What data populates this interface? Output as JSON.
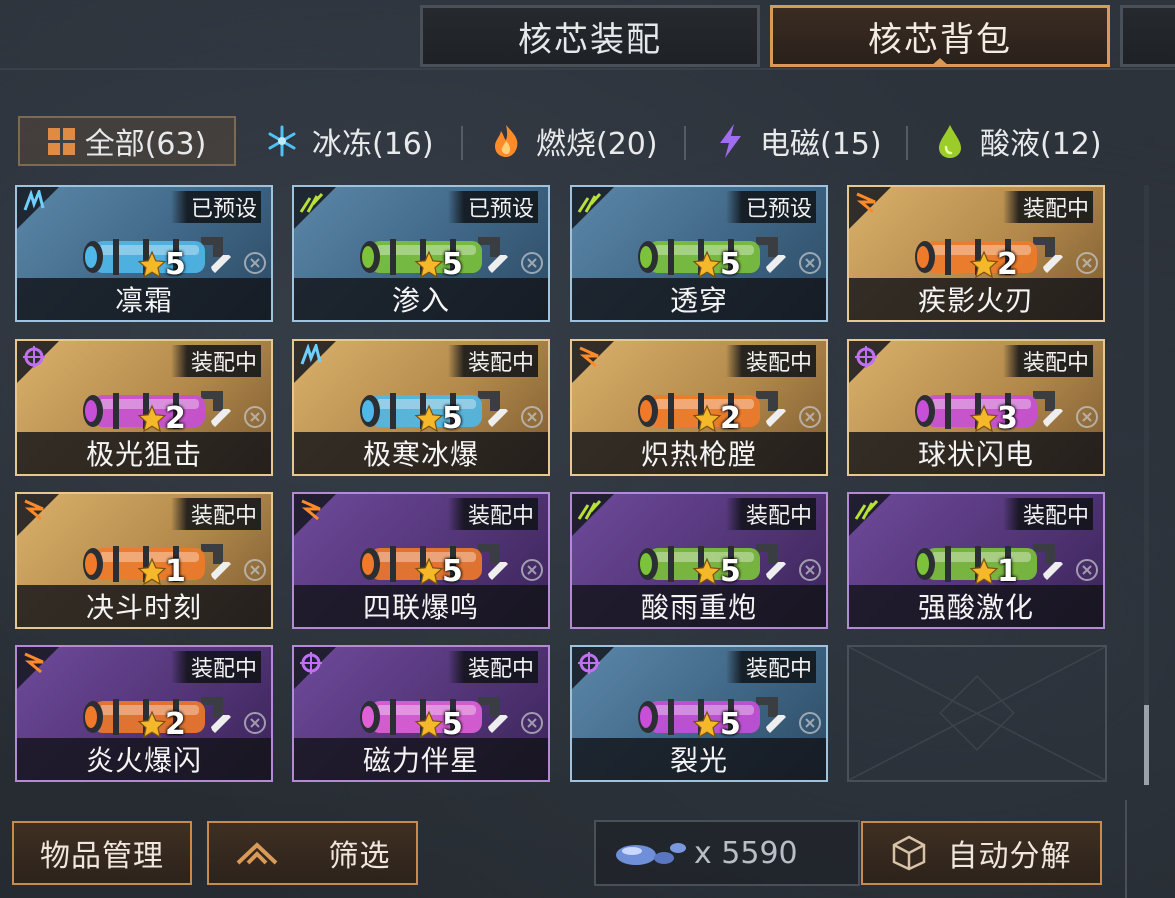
{
  "tabs": [
    {
      "label": "核芯装配",
      "active": false
    },
    {
      "label": "核芯背包",
      "active": true
    },
    {
      "label": "",
      "active": false
    }
  ],
  "filters": [
    {
      "label": "全部(63)",
      "icon": "grid-icon",
      "color": "#e08b44"
    },
    {
      "label": "冰冻(16)",
      "icon": "snowflake-icon",
      "color": "#4fc3f7"
    },
    {
      "label": "燃烧(20)",
      "icon": "flame-icon",
      "color": "#ff8a2a"
    },
    {
      "label": "电磁(15)",
      "icon": "lightning-icon",
      "color": "#a06cf0"
    },
    {
      "label": "酸液(12)",
      "icon": "acid-drop-icon",
      "color": "#9ccc2a"
    }
  ],
  "cores": [
    {
      "name": "凛霜",
      "status": "已预设",
      "rarity": "5",
      "frame": "blue",
      "element": "ice",
      "gun_color": "#4fb8e8"
    },
    {
      "name": "渗入",
      "status": "已预设",
      "rarity": "5",
      "frame": "blue",
      "element": "acid",
      "gun_color": "#7cc23a"
    },
    {
      "name": "透穿",
      "status": "已预设",
      "rarity": "5",
      "frame": "blue",
      "element": "acid",
      "gun_color": "#7cc23a"
    },
    {
      "name": "疾影火刃",
      "status": "装配中",
      "rarity": "2",
      "frame": "gold",
      "element": "fire",
      "gun_color": "#f07a2a"
    },
    {
      "name": "极光狙击",
      "status": "装配中",
      "rarity": "2",
      "frame": "gold",
      "element": "electro",
      "gun_color": "#c84fd8"
    },
    {
      "name": "极寒冰爆",
      "status": "装配中",
      "rarity": "5",
      "frame": "gold",
      "element": "ice",
      "gun_color": "#4fb8e8"
    },
    {
      "name": "炽热枪膛",
      "status": "装配中",
      "rarity": "2",
      "frame": "gold",
      "element": "fire",
      "gun_color": "#f07a2a"
    },
    {
      "name": "球状闪电",
      "status": "装配中",
      "rarity": "3",
      "frame": "gold",
      "element": "electro",
      "gun_color": "#c84fd8"
    },
    {
      "name": "决斗时刻",
      "status": "装配中",
      "rarity": "1",
      "frame": "gold",
      "element": "fire",
      "gun_color": "#f07a2a"
    },
    {
      "name": "四联爆鸣",
      "status": "装配中",
      "rarity": "5",
      "frame": "purple",
      "element": "fire",
      "gun_color": "#f07a2a"
    },
    {
      "name": "酸雨重炮",
      "status": "装配中",
      "rarity": "5",
      "frame": "purple",
      "element": "acid",
      "gun_color": "#7cc23a"
    },
    {
      "name": "强酸激化",
      "status": "装配中",
      "rarity": "1",
      "frame": "purple",
      "element": "acid",
      "gun_color": "#7cc23a"
    },
    {
      "name": "炎火爆闪",
      "status": "装配中",
      "rarity": "2",
      "frame": "purple",
      "element": "fire",
      "gun_color": "#f07a2a"
    },
    {
      "name": "磁力伴星",
      "status": "装配中",
      "rarity": "5",
      "frame": "purple",
      "element": "electro",
      "gun_color": "#e060d8"
    },
    {
      "name": "裂光",
      "status": "装配中",
      "rarity": "5",
      "frame": "blue",
      "element": "electro",
      "gun_color": "#c84fd8"
    }
  ],
  "bottom": {
    "manage_label": "物品管理",
    "filter_label": "筛选",
    "currency_amount": "x 5590",
    "auto_decompose_label": "自动分解"
  },
  "colors": {
    "accent": "#d99a58",
    "gold_frame": "#e6c890",
    "blue_frame": "#9fc3dc",
    "purple_frame": "#b48ad6",
    "star": "#f5b82a"
  }
}
